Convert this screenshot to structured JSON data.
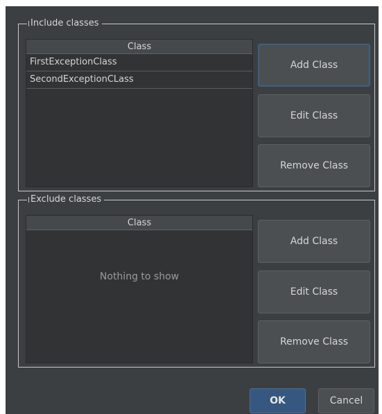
{
  "include": {
    "title": "Include classes",
    "column": "Class",
    "rows": [
      "FirstExceptionClass",
      "SecondExceptionCLass"
    ],
    "buttons": {
      "add": "Add Class",
      "edit": "Edit Class",
      "remove": "Remove Class"
    }
  },
  "exclude": {
    "title": "Exclude classes",
    "column": "Class",
    "empty_text": "Nothing to show",
    "buttons": {
      "add": "Add Class",
      "edit": "Edit Class",
      "remove": "Remove Class"
    }
  },
  "footer": {
    "ok": "OK",
    "cancel": "Cancel"
  },
  "colors": {
    "background": "#3c3f41",
    "accent": "#365880",
    "focus_border": "#3d6185"
  }
}
